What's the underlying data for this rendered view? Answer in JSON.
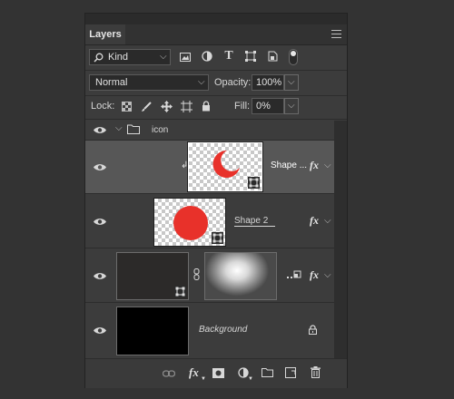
{
  "window": {
    "collapse_glyph": "◂◂",
    "close_glyph": "✕"
  },
  "panel": {
    "tab_label": "Layers",
    "filter": {
      "icon": "search-icon",
      "kind_value": "Kind"
    },
    "blend": {
      "mode_value": "Normal",
      "opacity_label": "Opacity:",
      "opacity_value": "100%"
    },
    "lock": {
      "label": "Lock:",
      "fill_label": "Fill:",
      "fill_value": "0%"
    },
    "filter_toggle_state": "on"
  },
  "layers": [
    {
      "name": "icon",
      "type": "group",
      "visible": true,
      "expanded": true
    },
    {
      "name": "Shape ...",
      "type": "shape",
      "visible": true,
      "clipped": true,
      "fx": "fx",
      "selected": true,
      "shape": "crescent",
      "shape_color": "#e8312a"
    },
    {
      "name": "Shape 2",
      "type": "shape",
      "visible": true,
      "fx": "fx",
      "shape": "circle",
      "shape_color": "#e8312a"
    },
    {
      "name": "",
      "type": "adjustment-masked",
      "visible": true,
      "fx": "fx"
    },
    {
      "name": "Background",
      "type": "background",
      "visible": true,
      "locked": true
    }
  ],
  "footer": {
    "icons": [
      "link-icon",
      "fx-icon",
      "mask-icon",
      "adjustment-icon",
      "folder-icon",
      "new-layer-icon",
      "trash-icon"
    ],
    "fx_label": "fx"
  }
}
